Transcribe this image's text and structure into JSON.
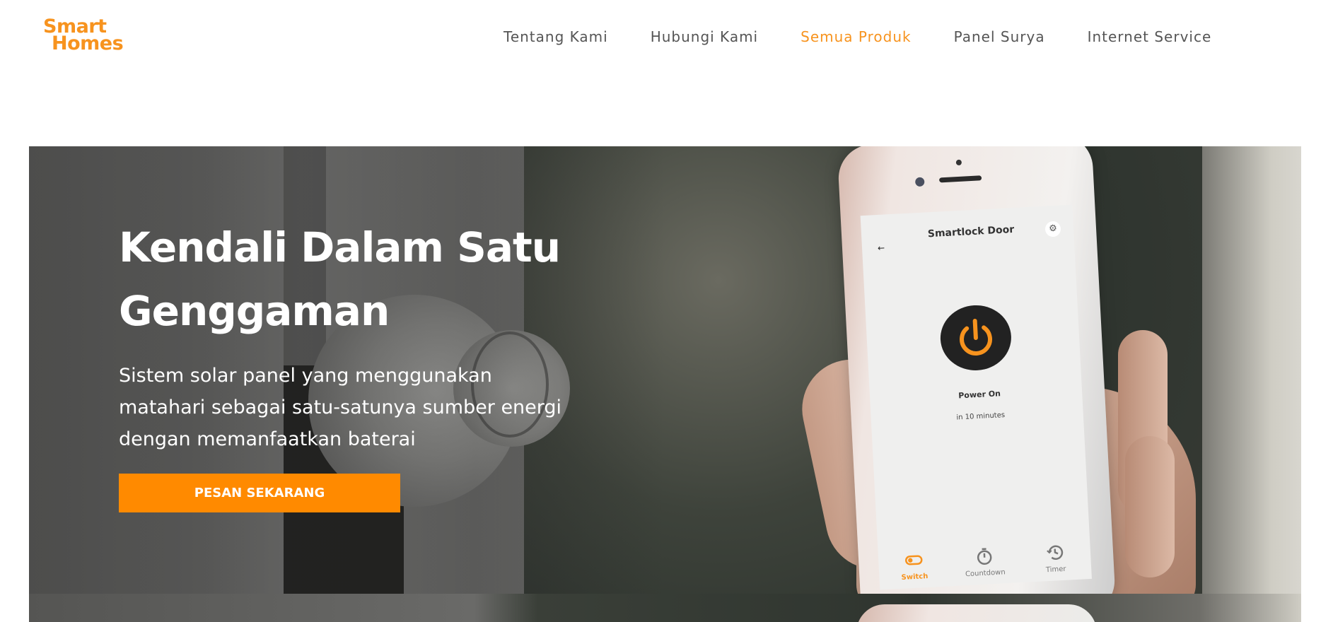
{
  "brand": {
    "line1": "Smart",
    "line2": "Homes",
    "color": "#f7931e"
  },
  "nav": {
    "items": [
      {
        "label": "Tentang Kami"
      },
      {
        "label": "Hubungi Kami"
      },
      {
        "label": "Semua Produk",
        "active": true
      },
      {
        "label": "Panel Surya"
      },
      {
        "label": "Internet Service"
      }
    ]
  },
  "hero": {
    "title": "Kendali Dalam Satu Genggaman",
    "description": "Sistem solar panel yang menggunakan matahari sebagai satu-satunya sumber energi dengan memanfaatkan baterai",
    "cta_label": "PESAN SEKARANG",
    "cta_color": "#ff8a00"
  },
  "phone_app": {
    "back": "←",
    "title": "Smartlock Door",
    "gear": "⚙",
    "status": "Power On",
    "substatus": "in 10 minutes",
    "tabs": [
      {
        "label": "Switch",
        "icon": "toggle-icon",
        "active": true
      },
      {
        "label": "Countdown",
        "icon": "stopwatch-icon"
      },
      {
        "label": "Timer",
        "icon": "clock-history-icon"
      }
    ]
  }
}
